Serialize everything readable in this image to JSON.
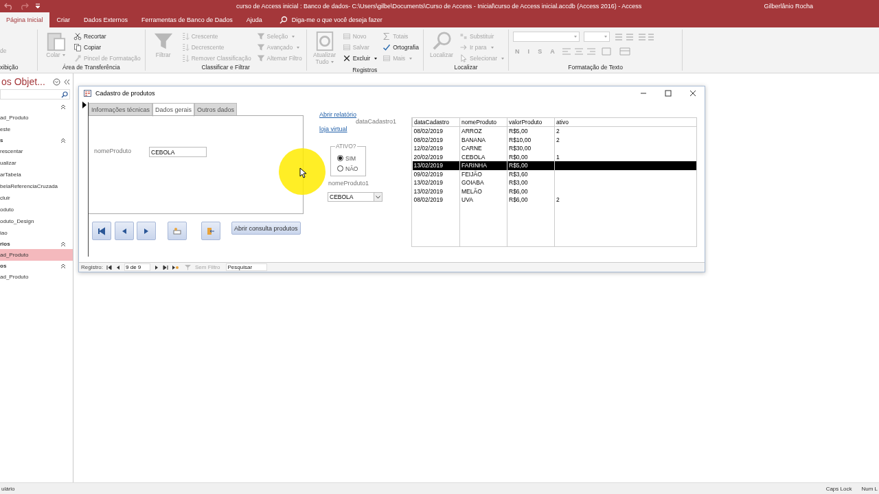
{
  "window": {
    "title": "curso de Access inicial : Banco de dados- C:\\Users\\gilbe\\Documents\\Curso de Access - Inicial\\curso de Access inicial.accdb (Access 2016)  -  Access",
    "user": "Gilberlânio Rocha"
  },
  "ribbon_tabs": [
    {
      "label": "Página Inicial",
      "selected": true
    },
    {
      "label": "Criar",
      "selected": false
    },
    {
      "label": "Dados Externos",
      "selected": false
    },
    {
      "label": "Ferramentas de Banco de Dados",
      "selected": false
    },
    {
      "label": "Ajuda",
      "selected": false
    }
  ],
  "tell_me": "Diga-me o que você deseja fazer",
  "ribbon_groups": [
    {
      "label": "xibição",
      "commands": [
        {
          "label": "de",
          "kind": "partial",
          "disabled": true
        }
      ]
    },
    {
      "label": "Área de Transferência",
      "commands": [
        {
          "label": "Colar",
          "kind": "large",
          "disabled": true,
          "dropdown": true
        },
        {
          "label": "Recortar",
          "kind": "small",
          "disabled": false
        },
        {
          "label": "Copiar",
          "kind": "small",
          "disabled": false
        },
        {
          "label": "Pincel de Formatação",
          "kind": "small",
          "disabled": true
        }
      ]
    },
    {
      "label": "Classificar e Filtrar",
      "commands": [
        {
          "label": "Filtrar",
          "kind": "large",
          "disabled": true
        },
        {
          "label": "Crescente",
          "kind": "small",
          "disabled": true
        },
        {
          "label": "Decrescente",
          "kind": "small",
          "disabled": true
        },
        {
          "label": "Remover Classificação",
          "kind": "small",
          "disabled": true
        },
        {
          "label": "Seleção",
          "kind": "small",
          "disabled": true,
          "dropdown": true
        },
        {
          "label": "Avançado",
          "kind": "small",
          "disabled": true,
          "dropdown": true
        },
        {
          "label": "Alternar Filtro",
          "kind": "small",
          "disabled": true
        }
      ]
    },
    {
      "label": "Registros",
      "commands": [
        {
          "label": "Atualizar Tudo",
          "kind": "large",
          "disabled": true,
          "dropdown": true
        },
        {
          "label": "Novo",
          "kind": "small",
          "disabled": true
        },
        {
          "label": "Salvar",
          "kind": "small",
          "disabled": true
        },
        {
          "label": "Excluir",
          "kind": "small",
          "disabled": false,
          "dropdown": true
        },
        {
          "label": "Totais",
          "kind": "small",
          "disabled": true
        },
        {
          "label": "Ortografia",
          "kind": "small",
          "disabled": false
        },
        {
          "label": "Mais",
          "kind": "small",
          "disabled": true,
          "dropdown": true
        }
      ]
    },
    {
      "label": "Localizar",
      "commands": [
        {
          "label": "Localizar",
          "kind": "large",
          "disabled": true
        },
        {
          "label": "Substituir",
          "kind": "small",
          "disabled": true
        },
        {
          "label": "Ir para",
          "kind": "small",
          "disabled": true,
          "dropdown": true
        },
        {
          "label": "Selecionar",
          "kind": "small",
          "disabled": true,
          "dropdown": true
        }
      ]
    },
    {
      "label": "Formatação de Texto",
      "commands": [
        {
          "label": "N",
          "kind": "format",
          "disabled": true
        },
        {
          "label": "I",
          "kind": "format",
          "disabled": true
        },
        {
          "label": "S",
          "kind": "format",
          "disabled": true
        },
        {
          "label": "A",
          "kind": "format",
          "disabled": true
        }
      ]
    }
  ],
  "nav_pane": {
    "title": "os Objet...",
    "sections": [
      {
        "items": [
          {
            "label": "ad_Produto",
            "selected": false
          },
          {
            "label": "este",
            "selected": false
          }
        ]
      },
      {
        "label": "s",
        "items": [
          {
            "label": "rescentar",
            "selected": false
          },
          {
            "label": "ualizar",
            "selected": false
          },
          {
            "label": "arTabela",
            "selected": false
          },
          {
            "label": "belaReferenciaCruzada",
            "selected": false
          },
          {
            "label": "cluir",
            "selected": false
          },
          {
            "label": "oduto",
            "selected": false
          },
          {
            "label": "oduto_Design",
            "selected": false
          },
          {
            "label": "iao",
            "selected": false
          }
        ]
      },
      {
        "label": "rios",
        "items": [
          {
            "label": "ad_Produto",
            "selected": true
          }
        ]
      },
      {
        "label": "os",
        "items": [
          {
            "label": "ad_Produto",
            "selected": false
          }
        ]
      }
    ]
  },
  "form": {
    "title": "Cadastro de produtos",
    "tabs": [
      {
        "label": "Informações técnicas",
        "selected": false
      },
      {
        "label": "Dados gerais",
        "selected": true
      },
      {
        "label": "Outros dados",
        "selected": false
      }
    ],
    "field_label": "nomeProduto",
    "field_value": "CEBOLA",
    "nav_buttons": [
      {
        "kind": "first"
      },
      {
        "kind": "prev"
      },
      {
        "kind": "next"
      },
      {
        "kind": "new"
      },
      {
        "kind": "exit"
      }
    ],
    "query_button": "Abrir consulta produtos",
    "links": [
      "Abrir relatório",
      "loja virtual"
    ],
    "date_label": "dataCadastro1",
    "option_group": {
      "label": "ATIVO?",
      "options": [
        {
          "label": "SIM",
          "selected": true
        },
        {
          "label": "NÃO",
          "selected": false
        }
      ]
    },
    "combo_label": "nomeProduto1",
    "combo_value": "CEBOLA",
    "datasheet": {
      "columns": [
        "dataCadastro",
        "nomeProduto",
        "valorProduto",
        "ativo"
      ],
      "rows": [
        {
          "cells": [
            "08/02/2019",
            "ARROZ",
            "R$5,00",
            "2"
          ],
          "selected": false
        },
        {
          "cells": [
            "08/02/2019",
            "BANANA",
            "R$10,00",
            "2"
          ],
          "selected": false
        },
        {
          "cells": [
            "12/02/2019",
            "CARNE",
            "R$30,00"
          ],
          "selected": false
        },
        {
          "cells": [
            "20/02/2019",
            "CEBOLA",
            "R$0,00",
            "1"
          ],
          "selected": false
        },
        {
          "cells": [
            "13/02/2019",
            "FARINHA",
            "R$5,00"
          ],
          "selected": true
        },
        {
          "cells": [
            "09/02/2019",
            "FEIJÃO",
            "R$3,60"
          ],
          "selected": false
        },
        {
          "cells": [
            "13/02/2019",
            "GOIABA",
            "R$3,00"
          ],
          "selected": false
        },
        {
          "cells": [
            "13/02/2019",
            "MELÃO",
            "R$6,00"
          ],
          "selected": false
        },
        {
          "cells": [
            "08/02/2019",
            "UVA",
            "R$6,00",
            "2"
          ],
          "selected": false
        }
      ]
    },
    "record_nav": {
      "label": "Registro:",
      "position": "9 de 9",
      "filter": {
        "label": "Sem Filtro",
        "disabled": true
      },
      "search": {
        "placeholder": "Pesquisar"
      }
    }
  },
  "status_bar": {
    "left": "ulário",
    "indicators": [
      "Caps Lock",
      "Num L"
    ]
  }
}
